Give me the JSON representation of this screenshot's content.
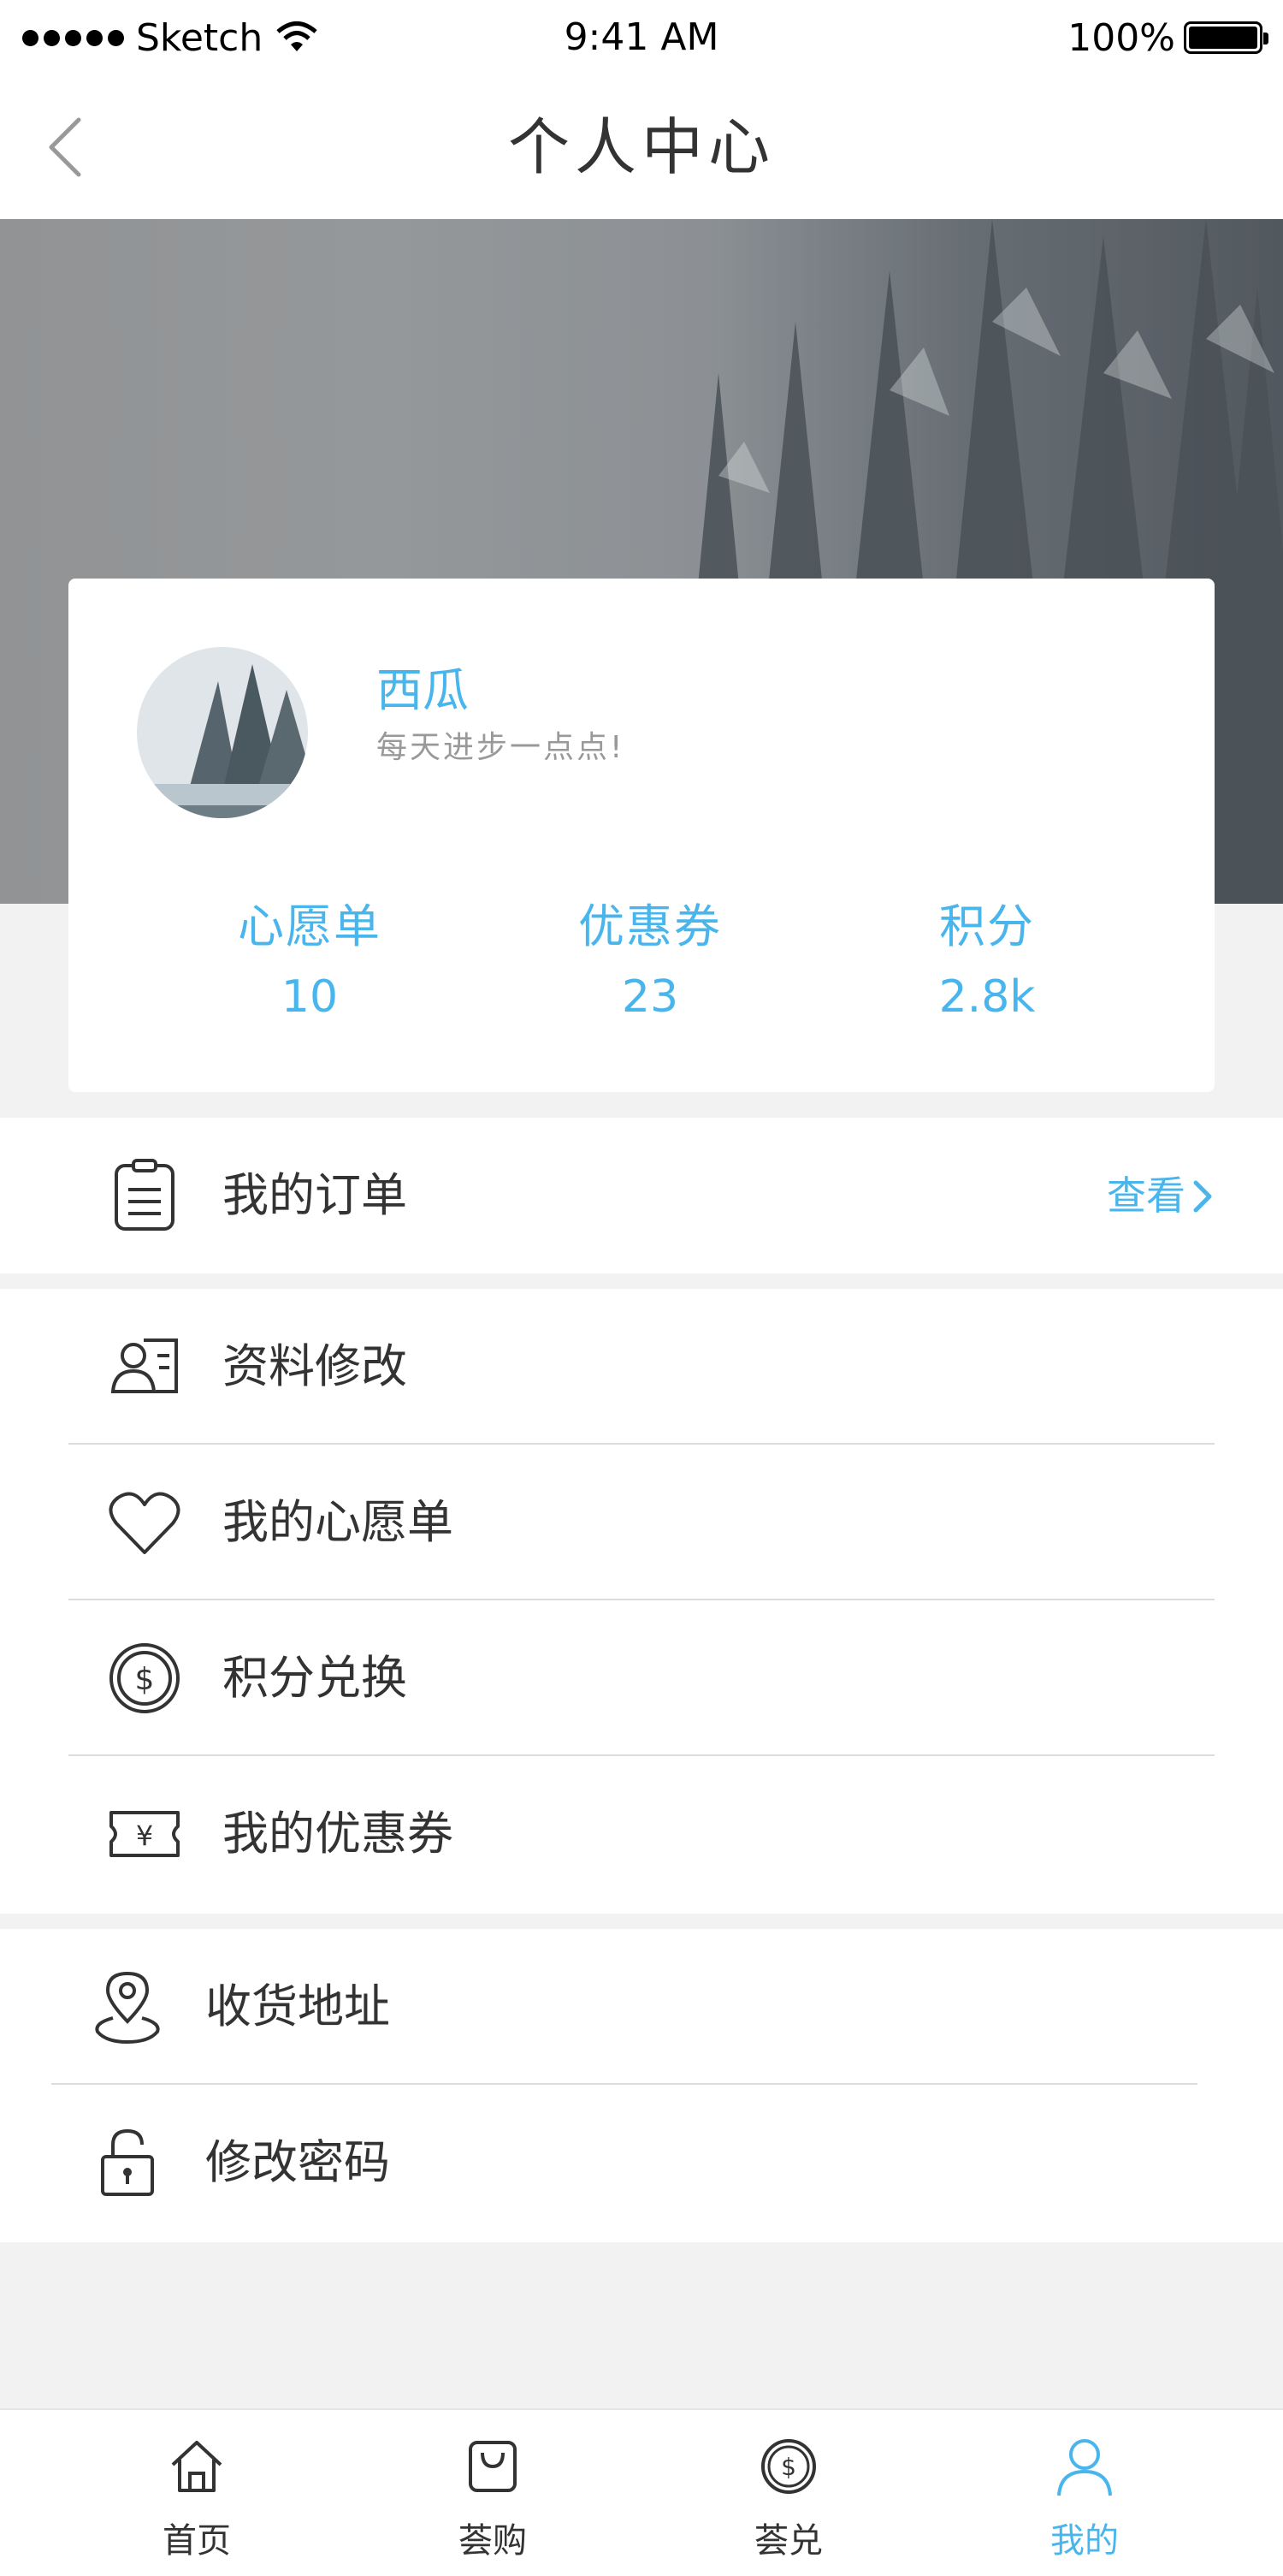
{
  "status_bar": {
    "carrier": "Sketch",
    "time": "9:41 AM",
    "battery": "100%"
  },
  "nav": {
    "title": "个人中心",
    "back_icon": "chevron-left-icon"
  },
  "profile": {
    "name": "西瓜",
    "motto": "每天进步一点点!",
    "stats": [
      {
        "label": "心愿单",
        "value": "10"
      },
      {
        "label": "优惠券",
        "value": "23"
      },
      {
        "label": "积分",
        "value": "2.8k"
      }
    ]
  },
  "orders": {
    "label": "我的订单",
    "link": "查看",
    "icon": "clipboard-icon"
  },
  "menu_group_1": [
    {
      "label": "资料修改",
      "icon": "id-card-icon"
    },
    {
      "label": "我的心愿单",
      "icon": "heart-icon"
    },
    {
      "label": "积分兑换",
      "icon": "coin-icon"
    },
    {
      "label": "我的优惠券",
      "icon": "ticket-icon"
    }
  ],
  "menu_group_2": [
    {
      "label": "收货地址",
      "icon": "location-pin-icon"
    },
    {
      "label": "修改密码",
      "icon": "lock-icon"
    }
  ],
  "tab_bar": [
    {
      "label": "首页",
      "icon": "home-icon"
    },
    {
      "label": "荟购",
      "icon": "shopping-bag-icon"
    },
    {
      "label": "荟兑",
      "icon": "coin-icon"
    },
    {
      "label": "我的",
      "icon": "user-icon",
      "active": true
    }
  ],
  "colors": {
    "accent": "#48b6ec",
    "text": "#333333",
    "background": "#f2f2f2"
  }
}
